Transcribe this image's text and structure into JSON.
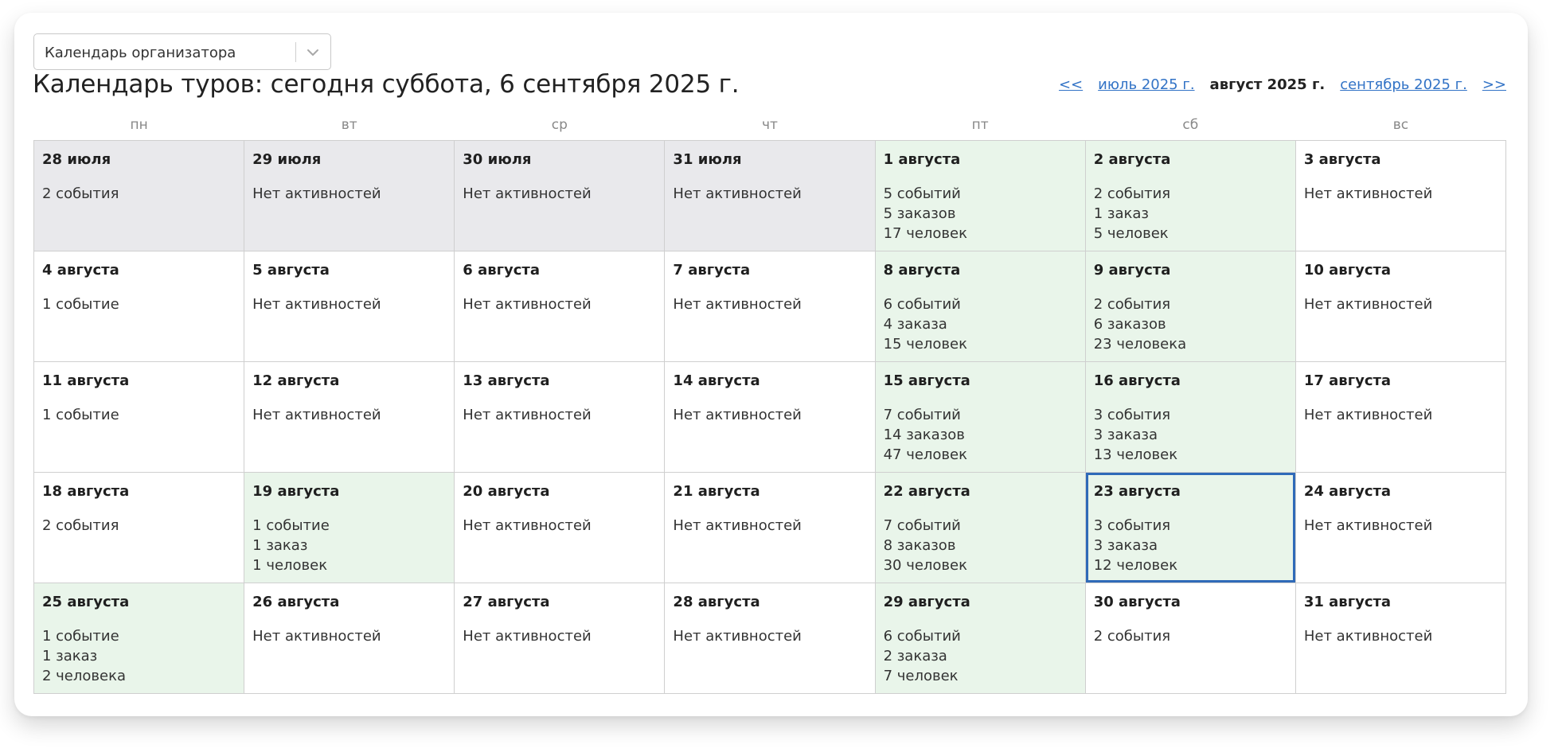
{
  "selector": {
    "value": "Календарь организатора"
  },
  "title": "Календарь туров: сегодня суббота, 6 сентября 2025 г.",
  "nav": {
    "prev_prev": "<<",
    "prev": "июль 2025 г.",
    "current": "август 2025 г.",
    "next": "сентябрь 2025 г.",
    "next_next": ">>"
  },
  "weekdays": [
    "пн",
    "вт",
    "ср",
    "чт",
    "пт",
    "сб",
    "вс"
  ],
  "weeks": [
    [
      {
        "label": "28 июля",
        "state": "past",
        "lines": [
          "2 события"
        ]
      },
      {
        "label": "29 июля",
        "state": "past",
        "lines": [
          "Нет активностей"
        ]
      },
      {
        "label": "30 июля",
        "state": "past",
        "lines": [
          "Нет активностей"
        ]
      },
      {
        "label": "31 июля",
        "state": "past",
        "lines": [
          "Нет активностей"
        ]
      },
      {
        "label": "1 августа",
        "state": "active",
        "lines": [
          "5 событий",
          "5 заказов",
          "17 человек"
        ]
      },
      {
        "label": "2 августа",
        "state": "active",
        "lines": [
          "2 события",
          "1 заказ",
          "5 человек"
        ]
      },
      {
        "label": "3 августа",
        "state": "normal",
        "lines": [
          "Нет активностей"
        ]
      }
    ],
    [
      {
        "label": "4 августа",
        "state": "normal",
        "lines": [
          "1 событие"
        ]
      },
      {
        "label": "5 августа",
        "state": "normal",
        "lines": [
          "Нет активностей"
        ]
      },
      {
        "label": "6 августа",
        "state": "normal",
        "lines": [
          "Нет активностей"
        ]
      },
      {
        "label": "7 августа",
        "state": "normal",
        "lines": [
          "Нет активностей"
        ]
      },
      {
        "label": "8 августа",
        "state": "active",
        "lines": [
          "6 событий",
          "4 заказа",
          "15 человек"
        ]
      },
      {
        "label": "9 августа",
        "state": "active",
        "lines": [
          "2 события",
          "6 заказов",
          "23 человека"
        ]
      },
      {
        "label": "10 августа",
        "state": "normal",
        "lines": [
          "Нет активностей"
        ]
      }
    ],
    [
      {
        "label": "11 августа",
        "state": "normal",
        "lines": [
          "1 событие"
        ]
      },
      {
        "label": "12 августа",
        "state": "normal",
        "lines": [
          "Нет активностей"
        ]
      },
      {
        "label": "13 августа",
        "state": "normal",
        "lines": [
          "Нет активностей"
        ]
      },
      {
        "label": "14 августа",
        "state": "normal",
        "lines": [
          "Нет активностей"
        ]
      },
      {
        "label": "15 августа",
        "state": "active",
        "lines": [
          "7 событий",
          "14 заказов",
          "47 человек"
        ]
      },
      {
        "label": "16 августа",
        "state": "active",
        "lines": [
          "3 события",
          "3 заказа",
          "13 человек"
        ]
      },
      {
        "label": "17 августа",
        "state": "normal",
        "lines": [
          "Нет активностей"
        ]
      }
    ],
    [
      {
        "label": "18 августа",
        "state": "normal",
        "lines": [
          "2 события"
        ]
      },
      {
        "label": "19 августа",
        "state": "active",
        "lines": [
          "1 событие",
          "1 заказ",
          "1 человек"
        ]
      },
      {
        "label": "20 августа",
        "state": "normal",
        "lines": [
          "Нет активностей"
        ]
      },
      {
        "label": "21 августа",
        "state": "normal",
        "lines": [
          "Нет активностей"
        ]
      },
      {
        "label": "22 августа",
        "state": "active",
        "lines": [
          "7 событий",
          "8 заказов",
          "30 человек"
        ]
      },
      {
        "label": "23 августа",
        "state": "active",
        "selected": true,
        "lines": [
          "3 события",
          "3 заказа",
          "12 человек"
        ]
      },
      {
        "label": "24 августа",
        "state": "normal",
        "lines": [
          "Нет активностей"
        ]
      }
    ],
    [
      {
        "label": "25 августа",
        "state": "active",
        "lines": [
          "1 событие",
          "1 заказ",
          "2 человека"
        ]
      },
      {
        "label": "26 августа",
        "state": "normal",
        "lines": [
          "Нет активностей"
        ]
      },
      {
        "label": "27 августа",
        "state": "normal",
        "lines": [
          "Нет активностей"
        ]
      },
      {
        "label": "28 августа",
        "state": "normal",
        "lines": [
          "Нет активностей"
        ]
      },
      {
        "label": "29 августа",
        "state": "active",
        "lines": [
          "6 событий",
          "2 заказа",
          "7 человек"
        ]
      },
      {
        "label": "30 августа",
        "state": "normal",
        "lines": [
          "2 события"
        ]
      },
      {
        "label": "31 августа",
        "state": "normal",
        "lines": [
          "Нет активностей"
        ]
      }
    ]
  ]
}
